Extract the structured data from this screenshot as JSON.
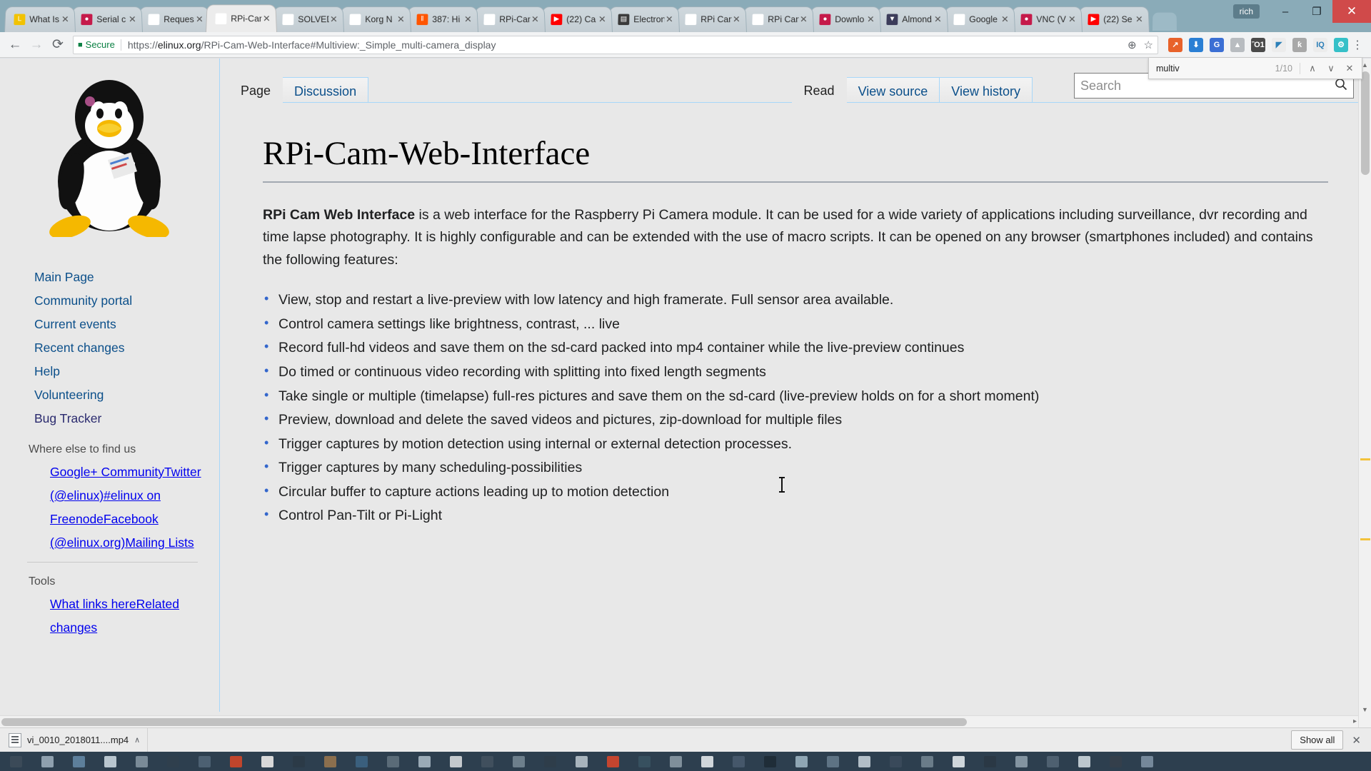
{
  "browser": {
    "tabs": [
      {
        "label": "What Is",
        "icon": "letter-l-icon",
        "color": "#f2c200",
        "glyph": "L",
        "active": false
      },
      {
        "label": "Serial c",
        "icon": "raspberry-pi-icon",
        "color": "#c51a4a",
        "glyph": "●",
        "active": false
      },
      {
        "label": "Reques",
        "icon": "github-icon",
        "color": "#ffffff",
        "glyph": "●",
        "active": false
      },
      {
        "label": "RPi-Cam",
        "icon": "tux-icon",
        "color": "#ffffff",
        "glyph": "●",
        "active": true
      },
      {
        "label": "SOLVED",
        "icon": "document-icon",
        "color": "#ffffff",
        "glyph": "□",
        "active": false
      },
      {
        "label": "Korg N",
        "icon": "korg-icon",
        "color": "#ffffff",
        "glyph": "◆",
        "active": false
      },
      {
        "label": "387: Hi",
        "icon": "soundcloud-icon",
        "color": "#ff5500",
        "glyph": "‖",
        "active": false
      },
      {
        "label": "RPi-Cam",
        "icon": "tux-icon",
        "color": "#ffffff",
        "glyph": "●",
        "active": false
      },
      {
        "label": "(22) Ca",
        "icon": "youtube-icon",
        "color": "#ff0000",
        "glyph": "▶",
        "active": false
      },
      {
        "label": "Electron",
        "icon": "store-icon",
        "color": "#3a3a3a",
        "glyph": "▤",
        "active": false
      },
      {
        "label": "RPi Cam",
        "icon": "document-icon",
        "color": "#ffffff",
        "glyph": "□",
        "active": false
      },
      {
        "label": "RPi Cam",
        "icon": "document-icon",
        "color": "#ffffff",
        "glyph": "□",
        "active": false
      },
      {
        "label": "Downlo",
        "icon": "raspberry-pi-icon",
        "color": "#c51a4a",
        "glyph": "●",
        "active": false
      },
      {
        "label": "Almond",
        "icon": "shield-icon",
        "color": "#3c3c5a",
        "glyph": "▼",
        "active": false
      },
      {
        "label": "Google",
        "icon": "google-icon",
        "color": "#ffffff",
        "glyph": "G",
        "active": false
      },
      {
        "label": "VNC (V",
        "icon": "raspberry-pi-icon",
        "color": "#c51a4a",
        "glyph": "●",
        "active": false
      },
      {
        "label": "(22) Se",
        "icon": "youtube-icon",
        "color": "#ff0000",
        "glyph": "▶",
        "active": false
      }
    ],
    "new_tab_label": "",
    "user_chip": "rich",
    "window_minimize": "–",
    "window_restore": "❐",
    "window_close": "✕",
    "back_label": "←",
    "forward_label": "→",
    "reload_label": "⟳",
    "lock_glyph": "■",
    "secure_label": "Secure",
    "url_scheme": "https://",
    "url_host": "elinux.org",
    "url_path": "/RPi-Cam-Web-Interface#Multiview:_Simple_multi-camera_display",
    "zoom_icon": "⊕",
    "bookmark_icon": "☆",
    "menu_icon": "⋮",
    "extensions": [
      {
        "name": "analytics-extension-icon",
        "color": "#e8622a",
        "glyph": "↗"
      },
      {
        "name": "download-extension-icon",
        "color": "#2a7fd4",
        "glyph": "⬇"
      },
      {
        "name": "google-translate-icon",
        "color": "#3b6fd4",
        "glyph": "G"
      },
      {
        "name": "drive-extension-icon",
        "color": "#b8bcc0",
        "glyph": "▲"
      },
      {
        "name": "lightbulb-extension-icon",
        "color": "#4a4a4a",
        "glyph": "Ὂ1"
      },
      {
        "name": "cast-icon",
        "color": "#ececec",
        "glyph": "◤"
      },
      {
        "name": "ghostery-extension-icon",
        "color": "#a8a8a8",
        "glyph": "ƙ"
      },
      {
        "name": "iq-extension-icon",
        "color": "#ececec",
        "glyph": "IQ"
      },
      {
        "name": "settings-extension-icon",
        "color": "#35c0c8",
        "glyph": "⚙"
      }
    ]
  },
  "findbar": {
    "query": "multiv",
    "count": "1/10",
    "prev_label": "∧",
    "next_label": "∨",
    "close_label": "✕"
  },
  "wiki": {
    "page_tabs_left": [
      {
        "label": "Page",
        "selected": true
      },
      {
        "label": "Discussion",
        "selected": false
      }
    ],
    "page_tabs_right": [
      {
        "label": "Read",
        "selected": true
      },
      {
        "label": "View source",
        "selected": false
      },
      {
        "label": "View history",
        "selected": false
      }
    ],
    "search": {
      "placeholder": "Search",
      "value": "",
      "icon": "search-icon"
    },
    "sidebar": {
      "logo_alt": "tux-linux-penguin-logo",
      "nav_items": [
        {
          "label": "Main Page",
          "visited": false
        },
        {
          "label": "Community portal",
          "visited": false
        },
        {
          "label": "Current events",
          "visited": false
        },
        {
          "label": "Recent changes",
          "visited": false
        },
        {
          "label": "Help",
          "visited": false
        },
        {
          "label": "Volunteering",
          "visited": false
        },
        {
          "label": "Bug Tracker",
          "visited": true
        }
      ],
      "section_find_us": {
        "heading": "Where else to find us",
        "items": [
          {
            "label": "Google+ Community",
            "visited": true
          },
          {
            "label": "Twitter (@elinux)",
            "visited": false
          },
          {
            "label": "#elinux on Freenode",
            "visited": false
          },
          {
            "label": "Facebook (@elinux.org)",
            "visited": false
          },
          {
            "label": "Mailing Lists",
            "visited": false
          }
        ]
      },
      "section_tools": {
        "heading": "Tools",
        "items": [
          {
            "label": "What links here",
            "visited": false
          },
          {
            "label": "Related changes",
            "visited": false
          }
        ]
      }
    },
    "article": {
      "title": "RPi-Cam-Web-Interface",
      "lead_bold": "RPi Cam Web Interface",
      "lead_rest": " is a web interface for the Raspberry Pi Camera module. It can be used for a wide variety of applications including surveillance, dvr recording and time lapse photography. It is highly configurable and can be extended with the use of macro scripts. It can be opened on any browser (smartphones included) and contains the following features:",
      "features": [
        "View, stop and restart a live-preview with low latency and high framerate. Full sensor area available.",
        "Control camera settings like brightness, contrast, ... live",
        "Record full-hd videos and save them on the sd-card packed into mp4 container while the live-preview continues",
        "Do timed or continuous video recording with splitting into fixed length segments",
        "Take single or multiple (timelapse) full-res pictures and save them on the sd-card (live-preview holds on for a short moment)",
        "Preview, download and delete the saved videos and pictures, zip-download for multiple files",
        "Trigger captures by motion detection using internal or external detection processes.",
        "Trigger captures by many scheduling-possibilities",
        "Circular buffer to capture actions leading up to motion detection",
        "Control Pan-Tilt or Pi-Light"
      ]
    }
  },
  "downloads": {
    "file_name": "vi_0010_2018011....mp4",
    "file_icon": "video-file-icon",
    "caret_label": "∧",
    "show_all_label": "Show all",
    "close_label": "✕"
  },
  "colors": {
    "tabstrip": "#8aabb8",
    "link": "#0b4f8a",
    "link_visited": "#2a2a6e",
    "wiki_border": "#a7d7f9",
    "page_bg": "#e8e8e8",
    "taskbar": "#2d3f4f",
    "secure_green": "#0b8043"
  }
}
